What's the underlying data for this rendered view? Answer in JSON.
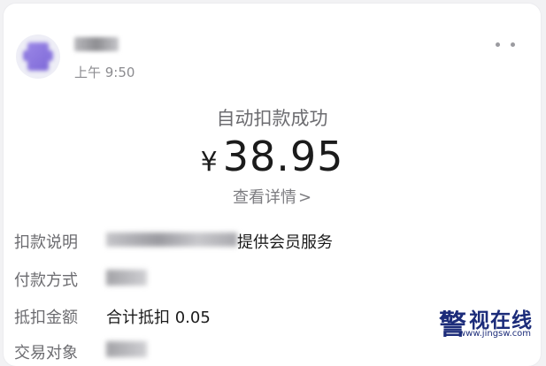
{
  "message": {
    "time": "上午 9:50"
  },
  "receipt": {
    "status_title": "自动扣款成功",
    "currency_symbol": "¥",
    "amount": "38.95",
    "detail_link": "查看详情",
    "detail_chevron": ">"
  },
  "rows": [
    {
      "label": "扣款说明",
      "value": "提供会员服务"
    },
    {
      "label": "付款方式",
      "value": ""
    },
    {
      "label": "抵扣金额",
      "value": "合计抵扣 0.05"
    },
    {
      "label": "交易对象",
      "value": ""
    }
  ],
  "watermark": {
    "seal": "警",
    "name": "视在线",
    "url": "www.jingsw.com"
  },
  "icons": [
    "avatar",
    "more-icon",
    "chevron-right-icon"
  ]
}
